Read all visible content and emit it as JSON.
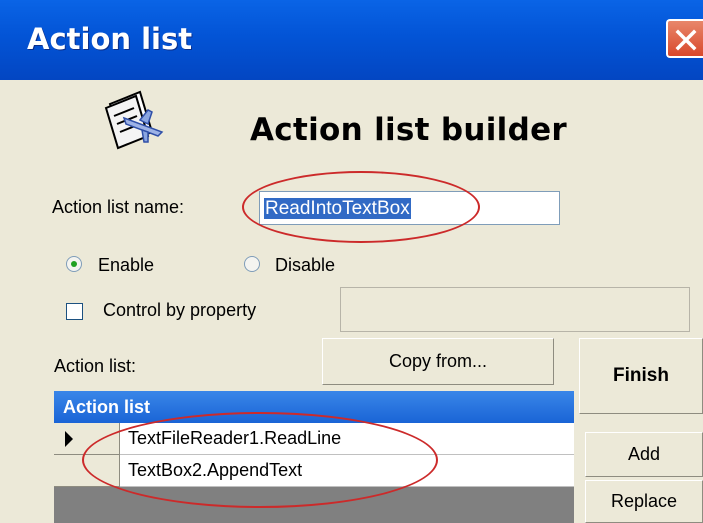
{
  "window": {
    "title": "Action list"
  },
  "header": {
    "heading": "Action list builder",
    "icon": "airplane-document-icon"
  },
  "form": {
    "name_label": "Action list name:",
    "name_value": "ReadIntoTextBox",
    "enable_label": "Enable",
    "disable_label": "Disable",
    "enable_selected": true,
    "control_by_property_label": "Control by property",
    "control_by_property_checked": false,
    "property_value": ""
  },
  "actions": {
    "section_label": "Action list:",
    "copy_from_label": "Copy from...",
    "finish_label": "Finish",
    "add_label": "Add",
    "replace_label": "Replace",
    "grid_header": "Action list",
    "rows": [
      {
        "text": "TextFileReader1.ReadLine",
        "current": true
      },
      {
        "text": "TextBox2.AppendText",
        "current": false
      }
    ]
  },
  "colors": {
    "titlebar": "#0354d6",
    "annotation": "#cc2a2a",
    "selection": "#316ac5"
  }
}
